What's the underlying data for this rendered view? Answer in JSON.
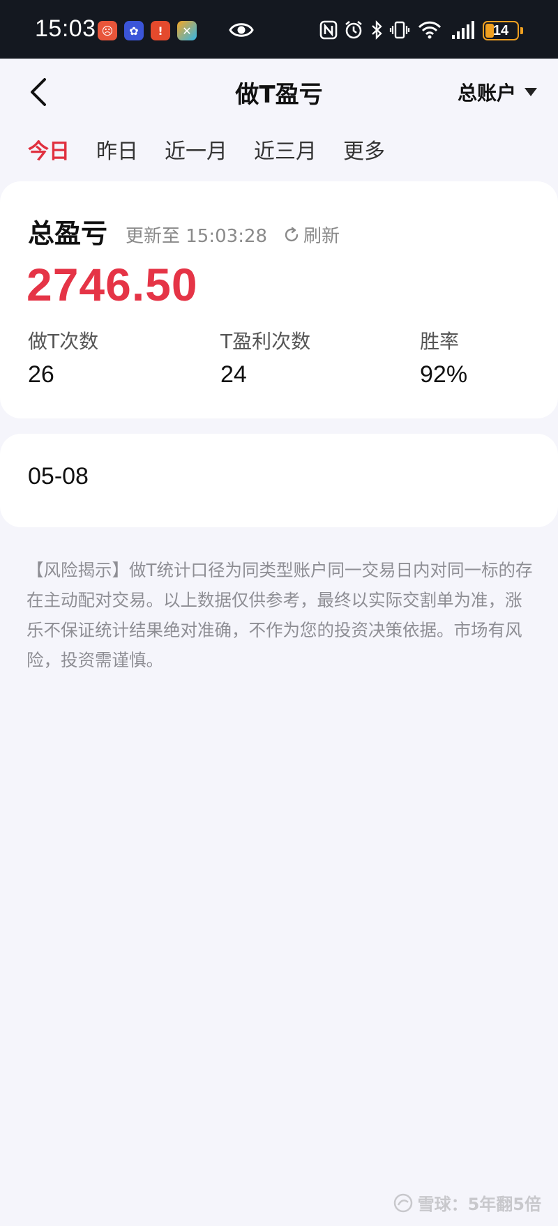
{
  "status_bar": {
    "time": "15:03",
    "battery_level": "14",
    "app_icons": [
      "notification-app-icon",
      "notification-app-icon",
      "notification-app-icon",
      "notification-app-icon"
    ],
    "system_icons": [
      "eye-icon",
      "nfc-icon",
      "alarm-icon",
      "bluetooth-icon",
      "vibrate-icon",
      "wifi-icon",
      "signal-icon",
      "battery-icon"
    ]
  },
  "header": {
    "title": "做T盈亏",
    "account_selector": "总账户"
  },
  "tabs": [
    {
      "label": "今日",
      "active": true
    },
    {
      "label": "昨日",
      "active": false
    },
    {
      "label": "近一月",
      "active": false
    },
    {
      "label": "近三月",
      "active": false
    },
    {
      "label": "更多",
      "active": false
    }
  ],
  "summary": {
    "title": "总盈亏",
    "update_text": "更新至 15:03:28",
    "refresh_label": "刷新",
    "total_value": "2746.50",
    "stats": [
      {
        "label": "做T次数",
        "value": "26"
      },
      {
        "label": "T盈利次数",
        "value": "24"
      },
      {
        "label": "胜率",
        "value": "92%"
      }
    ]
  },
  "date_card": {
    "date": "05-08"
  },
  "disclaimer": "【风险揭示】做T统计口径为同类型账户同一交易日内对同一标的存在主动配对交易。以上数据仅供参考，最终以实际交割单为准，涨乐不保证统计结果绝对准确，不作为您的投资决策依据。市场有风险，投资需谨慎。",
  "watermark": "雪球：5年翻5倍",
  "colors": {
    "accent_red": "#e53446",
    "background": "#f5f5fb",
    "status_bar_bg": "#141820"
  }
}
